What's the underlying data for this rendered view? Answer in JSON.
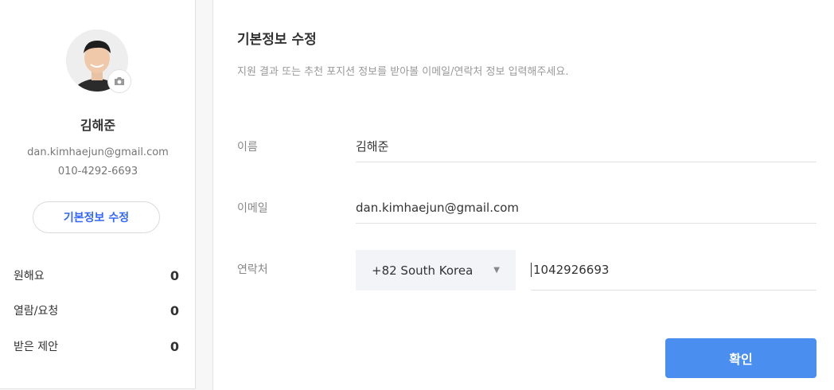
{
  "profile": {
    "name": "김해준",
    "email": "dan.kimhaejun@gmail.com",
    "phone": "010-4292-6693",
    "edit_button": "기본정보 수정",
    "stats": [
      {
        "label": "원해요",
        "value": "0"
      },
      {
        "label": "열람/요청",
        "value": "0"
      },
      {
        "label": "받은 제안",
        "value": "0"
      }
    ]
  },
  "form": {
    "title": "기본정보 수정",
    "subtitle": "지원 결과 또는 추천 포지션 정보를 받아볼 이메일/연락처 정보 입력해주세요.",
    "name_label": "이름",
    "name_value": "김해준",
    "email_label": "이메일",
    "email_value": "dan.kimhaejun@gmail.com",
    "phone_label": "연락처",
    "country_value": "+82 South Korea",
    "phone_value": "1042926693",
    "confirm_button": "확인"
  },
  "icons": {
    "camera": "camera-icon",
    "caret": "caret-down-icon"
  },
  "colors": {
    "accent": "#3366ff",
    "button": "#4a8ff0"
  }
}
